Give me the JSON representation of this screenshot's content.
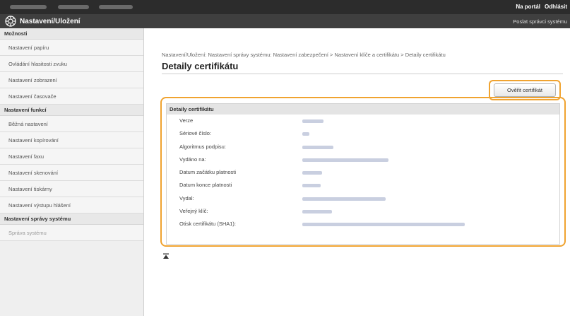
{
  "top_links": {
    "portal": "Na portál",
    "logout": "Odhlásit"
  },
  "header": {
    "title": "Nastavení/Uložení",
    "admin_link": "Poslat správci systému"
  },
  "sidebar": {
    "section1": "Možnosti",
    "items1": [
      {
        "label": "Nastavení papíru"
      },
      {
        "label": "Ovládání hlasitosti zvuku"
      },
      {
        "label": "Nastavení zobrazení"
      },
      {
        "label": "Nastavení časovače"
      }
    ],
    "section2": "Nastavení funkcí",
    "items2": [
      {
        "label": "Běžná nastavení"
      },
      {
        "label": "Nastavení kopírování"
      },
      {
        "label": "Nastavení faxu"
      },
      {
        "label": "Nastavení skenování"
      },
      {
        "label": "Nastavení tiskárny"
      },
      {
        "label": "Nastavení výstupu hlášení"
      }
    ],
    "section3": "Nastavení správy systému",
    "items3": [
      {
        "label": "Správa systému"
      }
    ]
  },
  "main": {
    "breadcrumb": "Nastavení/Uložení: Nastavení správy systému: Nastavení zabezpečení > Nastavení klíče a certifikátu > Detaily certifikátu",
    "title": "Detaily certifikátu",
    "verify_button": "Ověřit certifikát",
    "details": {
      "heading": "Detaily certifikátu",
      "rows": [
        {
          "label": "Verze"
        },
        {
          "label": "Sériové číslo:"
        },
        {
          "label": "Algoritmus podpisu:"
        },
        {
          "label": "Vydáno na:"
        },
        {
          "label": "Datum začátku platnosti"
        },
        {
          "label": "Datum konce platnosti"
        },
        {
          "label": "Vydal:"
        },
        {
          "label": "Veřejný klíč:"
        },
        {
          "label": "Otisk certifikátu (SHA1):"
        }
      ]
    }
  },
  "colors": {
    "highlight": "#f0a330",
    "topbar": "#2c2c2c",
    "titlebar": "#3f3f3f"
  }
}
